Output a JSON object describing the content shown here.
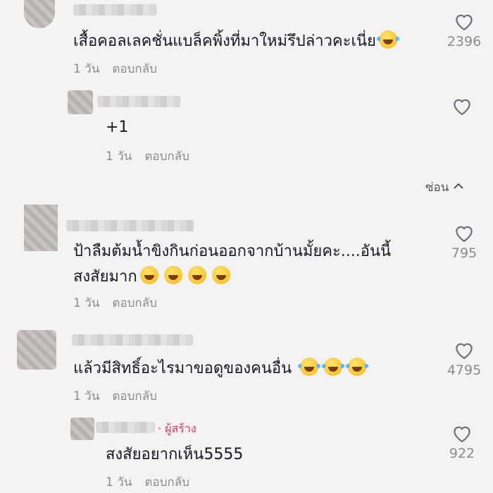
{
  "comments": [
    {
      "text": "เสื้อคอลเลคชั่นแบล็คพิ้งที่มาใหม่รึปล่าวคะเนี่ย",
      "emojis": [
        "laugh-cry"
      ],
      "time": "1 วัน",
      "reply": "ตอบกลับ",
      "likes": "2396"
    },
    {
      "text": "+1",
      "time": "1 วัน",
      "reply": "ตอบกลับ",
      "likes": ""
    },
    {
      "text_line1": "ป้าลืมต้มน้ำขิงกินก่อนออกจากบ้านมั้ยคะ....อันนี้",
      "text_line2": "สงสัยมาก",
      "emojis": [
        "grin",
        "grin",
        "grin",
        "grin"
      ],
      "time": "1 วัน",
      "reply": "ตอบกลับ",
      "likes": "795"
    },
    {
      "text": "แล้วมีสิทธิ์อะไรมาขอดูของคนอื่น",
      "emojis": [
        "laugh-cry",
        "laugh-cry",
        "laugh-cry"
      ],
      "time": "1 วัน",
      "reply": "ตอบกลับ",
      "likes": "4795"
    },
    {
      "creator_badge": "· ผู้สร้าง",
      "text": "สงสัยอยากเห็น5555",
      "time": "1 วัน",
      "reply": "ตอบกลับ",
      "likes": "922"
    }
  ],
  "hide_label": "ซ่อน",
  "icons": {
    "like": "heart-outline-icon",
    "collapse": "chevron-up-icon",
    "emoji_grin": "grin-emoji-icon",
    "emoji_laugh": "laugh-cry-emoji-icon"
  }
}
